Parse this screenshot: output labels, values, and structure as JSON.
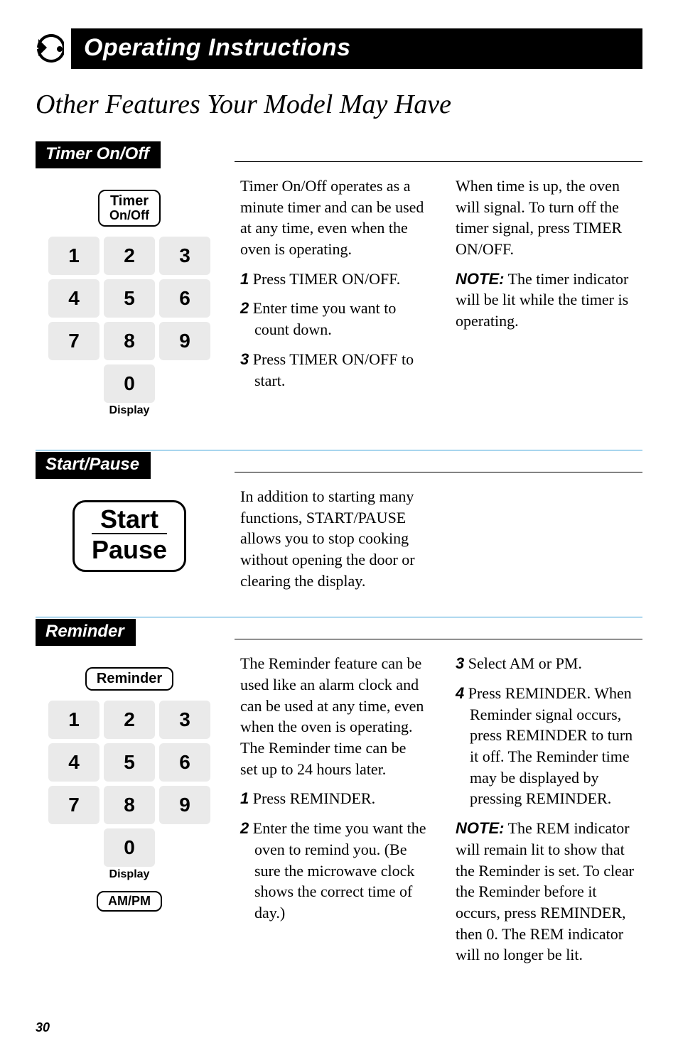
{
  "header": {
    "title": "Operating Instructions"
  },
  "page_title": "Other Features Your Model May Have",
  "sections": {
    "timer": {
      "heading": "Timer On/Off",
      "panel": {
        "label_line1": "Timer",
        "label_line2": "On/Off",
        "keys": [
          "1",
          "2",
          "3",
          "4",
          "5",
          "6",
          "7",
          "8",
          "9",
          "0"
        ],
        "display": "Display"
      },
      "col1": {
        "intro": "Timer On/Off operates as a minute timer and can be used at any time, even when the oven is operating.",
        "step1_num": "1",
        "step1": "Press TIMER ON/OFF.",
        "step2_num": "2",
        "step2": "Enter time you want to count down.",
        "step3_num": "3",
        "step3": "Press TIMER ON/OFF to start."
      },
      "col2": {
        "p1": "When time is up, the oven will signal. To turn off the timer signal, press TIMER ON/OFF.",
        "note_label": "NOTE:",
        "note_body": "The timer indicator will be lit while the timer is operating."
      }
    },
    "startpause": {
      "heading": "Start/Pause",
      "panel": {
        "line1": "Start",
        "line2": "Pause"
      },
      "body": "In addition to starting many functions, START/PAUSE allows you to stop cooking without opening the door or clearing the display."
    },
    "reminder": {
      "heading": "Reminder",
      "panel": {
        "label": "Reminder",
        "keys": [
          "1",
          "2",
          "3",
          "4",
          "5",
          "6",
          "7",
          "8",
          "9",
          "0"
        ],
        "display": "Display",
        "ampm": "AM/PM"
      },
      "col1": {
        "intro": "The Reminder feature can be used like an alarm clock and can be used at any time, even when the oven is operating. The Reminder time can be set up to 24 hours later.",
        "step1_num": "1",
        "step1": "Press REMINDER.",
        "step2_num": "2",
        "step2": "Enter the time you want the oven to remind you. (Be sure the microwave clock shows the correct time of day.)"
      },
      "col2": {
        "step3_num": "3",
        "step3": "Select AM or PM.",
        "step4_num": "4",
        "step4": "Press REMINDER. When Reminder signal occurs, press REMINDER to turn it off. The Reminder time may be displayed by pressing REMINDER.",
        "note_label": "NOTE:",
        "note_body": "The REM indicator will remain lit to show that the Reminder is set. To clear the Reminder before it occurs, press REMINDER, then 0. The REM indicator will no longer be lit."
      }
    }
  },
  "page_number": "30"
}
